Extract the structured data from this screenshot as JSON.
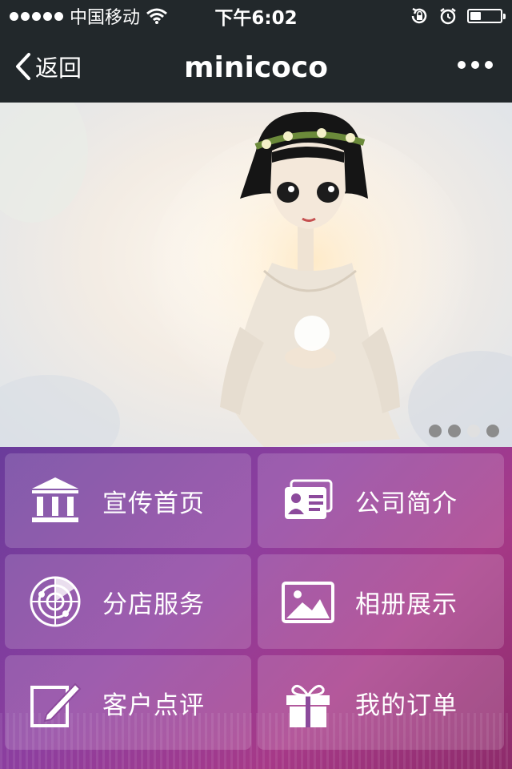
{
  "status_bar": {
    "carrier": "中国移动",
    "time": "下午6:02",
    "battery_level": 0.35
  },
  "nav": {
    "back_label": "返回",
    "title": "minicoco"
  },
  "banner": {
    "active_index": 2,
    "slides": 4
  },
  "menu": [
    {
      "label": "宣传首页",
      "icon": "bank-icon"
    },
    {
      "label": "公司简介",
      "icon": "business-card-icon"
    },
    {
      "label": "分店服务",
      "icon": "radar-icon"
    },
    {
      "label": "相册展示",
      "icon": "photo-icon"
    },
    {
      "label": "客户点评",
      "icon": "pencil-edit-icon"
    },
    {
      "label": "我的订单",
      "icon": "gift-icon"
    }
  ],
  "colors": {
    "bar": "#22282b",
    "menu_start": "#6a3c9b",
    "menu_end": "#a63988"
  }
}
